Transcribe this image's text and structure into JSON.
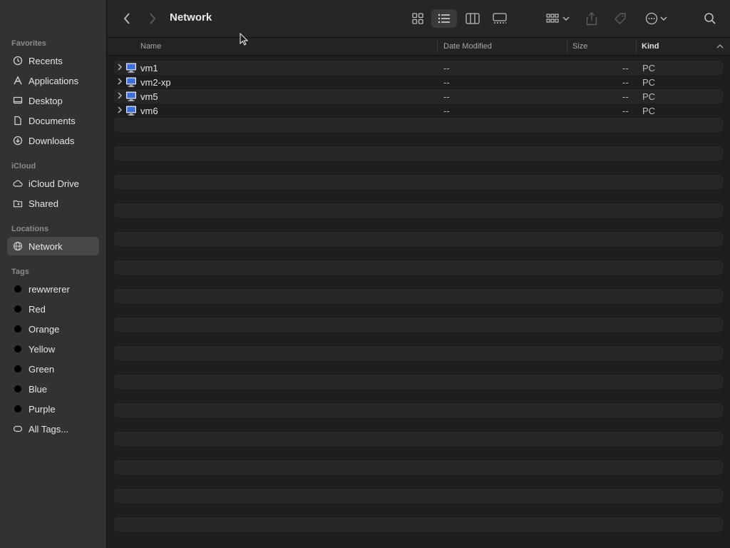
{
  "sidebar": {
    "sections": {
      "favorites": "Favorites",
      "icloud": "iCloud",
      "locations": "Locations",
      "tags": "Tags"
    },
    "favorites": [
      {
        "label": "Recents",
        "icon": "clock-icon"
      },
      {
        "label": "Applications",
        "icon": "applications-icon"
      },
      {
        "label": "Desktop",
        "icon": "desktop-icon"
      },
      {
        "label": "Documents",
        "icon": "document-icon"
      },
      {
        "label": "Downloads",
        "icon": "download-icon"
      }
    ],
    "icloud": [
      {
        "label": "iCloud Drive",
        "icon": "cloud-icon"
      },
      {
        "label": "Shared",
        "icon": "shared-folder-icon"
      }
    ],
    "locations": [
      {
        "label": "Network",
        "icon": "globe-icon",
        "selected": true
      }
    ],
    "tags": [
      {
        "label": "rewwrerer",
        "color": "#000000"
      },
      {
        "label": "Red",
        "color": "#000000"
      },
      {
        "label": "Orange",
        "color": "#000000"
      },
      {
        "label": "Yellow",
        "color": "#000000"
      },
      {
        "label": "Green",
        "color": "#000000"
      },
      {
        "label": "Blue",
        "color": "#000000"
      },
      {
        "label": "Purple",
        "color": "#000000"
      }
    ],
    "all_tags": "All Tags..."
  },
  "toolbar": {
    "title": "Network"
  },
  "columns": {
    "name": "Name",
    "date_modified": "Date Modified",
    "size": "Size",
    "kind": "Kind"
  },
  "rows": [
    {
      "name": "vm1",
      "date": "--",
      "size": "--",
      "kind": "PC"
    },
    {
      "name": "vm2-xp",
      "date": "--",
      "size": "--",
      "kind": "PC"
    },
    {
      "name": "vm5",
      "date": "--",
      "size": "--",
      "kind": "PC"
    },
    {
      "name": "vm6",
      "date": "--",
      "size": "--",
      "kind": "PC"
    }
  ],
  "colors": {
    "sidebar_bg": "#323234",
    "content_bg": "#1e1e1e",
    "selection": "#48484b",
    "pc_icon": "#3a6fd8"
  }
}
